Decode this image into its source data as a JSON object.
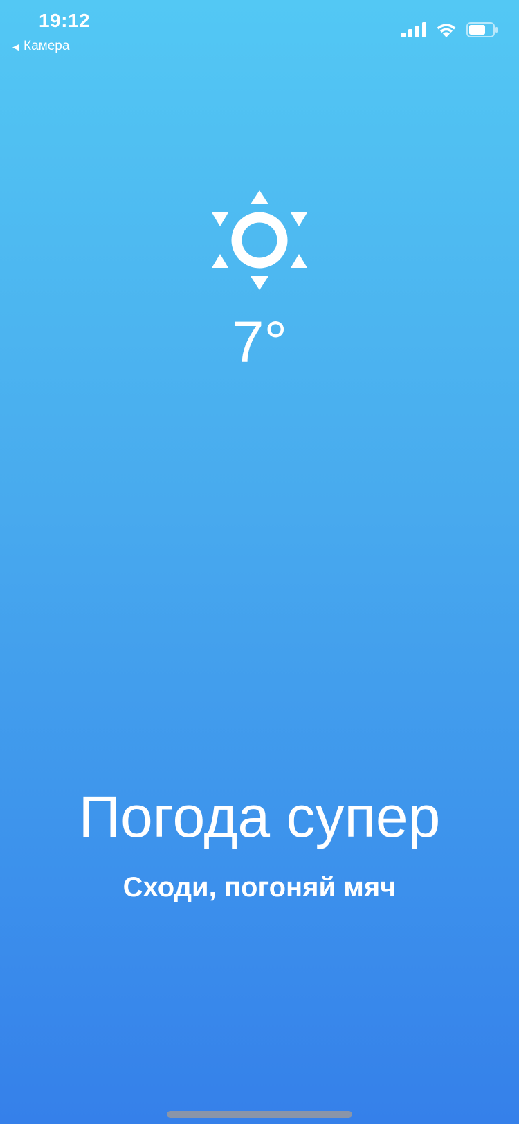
{
  "status_bar": {
    "time": "19:12",
    "back_label": "Камера",
    "signal_icon": "cellular-signal-icon",
    "wifi_icon": "wifi-icon",
    "battery_icon": "battery-icon"
  },
  "weather": {
    "icon": "sun-icon",
    "temperature": "7°"
  },
  "message": {
    "headline": "Погода супер",
    "subline": "Сходи, погоняй мяч"
  },
  "colors": {
    "background_top": "#53c8f4",
    "background_bottom": "#3580ea",
    "text": "#ffffff"
  }
}
